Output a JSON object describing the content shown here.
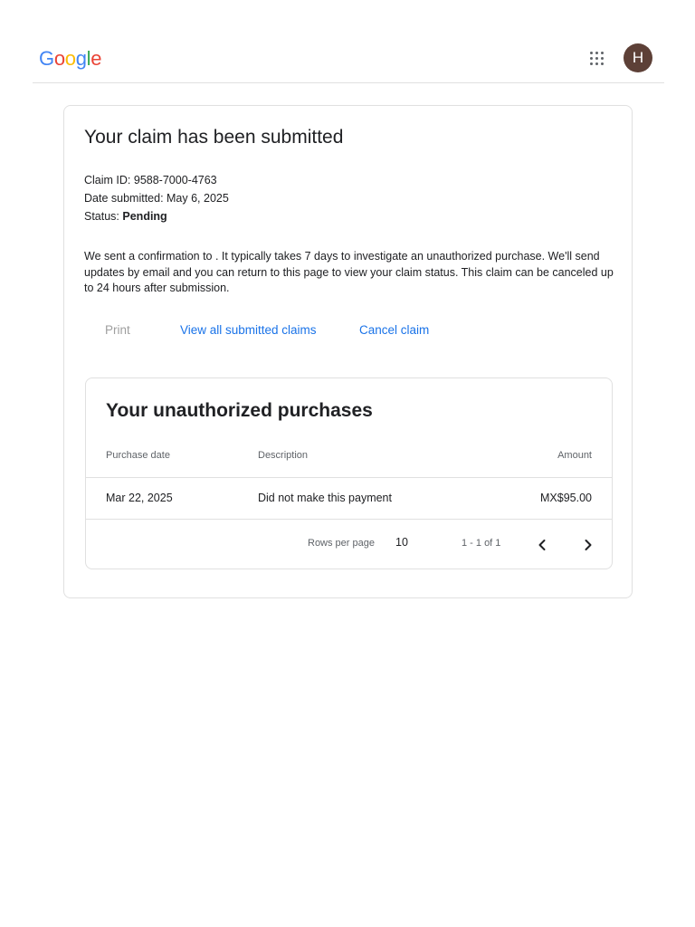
{
  "header": {
    "logo_letters": [
      "G",
      "o",
      "o",
      "g",
      "l",
      "e"
    ],
    "logo_colors": [
      "#4285F4",
      "#EA4335",
      "#FBBC05",
      "#4285F4",
      "#34A853",
      "#EA4335"
    ],
    "avatar_initial": "H",
    "avatar_color": "#5d4037"
  },
  "claim": {
    "title": "Your claim has been submitted",
    "claim_id_label": "Claim ID: ",
    "claim_id": "9588-7000-4763",
    "date_label": "Date submitted: ",
    "date": "May 6, 2025",
    "status_label": "Status: ",
    "status": "Pending",
    "description": "We sent a confirmation to . It typically takes 7 days to investigate an unauthorized purchase. We'll send updates by email and you can return to this page to view your claim status. This claim can be canceled up to 24 hours after submission."
  },
  "actions": {
    "print": "Print",
    "view_all": "View all submitted claims",
    "cancel": "Cancel claim"
  },
  "purchases": {
    "title": "Your unauthorized purchases",
    "columns": {
      "date": "Purchase date",
      "description": "Description",
      "amount": "Amount"
    },
    "rows": [
      {
        "date": "Mar 22, 2025",
        "description": "Did not make this payment",
        "amount": "MX$95.00"
      }
    ],
    "pagination": {
      "rows_per_page_label": "Rows per page",
      "rows_per_page": "10",
      "range": "1 - 1 of 1"
    }
  },
  "colors": {
    "link": "#1a73e8",
    "disabled": "#9e9e9e",
    "border": "#e0e0e0"
  }
}
